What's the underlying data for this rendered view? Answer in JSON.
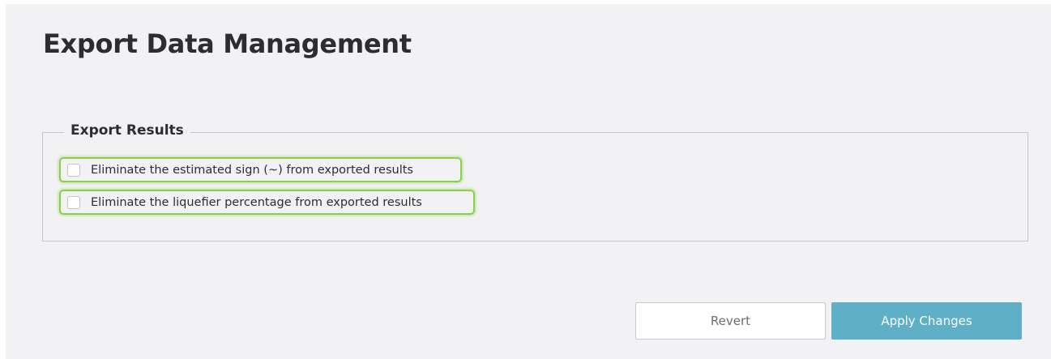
{
  "page": {
    "title": "Export Data Management"
  },
  "export_results": {
    "legend": "Export Results",
    "options": [
      {
        "label": "Eliminate the estimated sign (~) from exported results",
        "checked": false
      },
      {
        "label": "Eliminate the liquefier percentage from exported results",
        "checked": false
      }
    ]
  },
  "actions": {
    "revert_label": "Revert",
    "apply_label": "Apply Changes"
  },
  "colors": {
    "background": "#f2f2f4",
    "highlight": "#8ccf4d",
    "apply_button": "#5fb0c6"
  }
}
